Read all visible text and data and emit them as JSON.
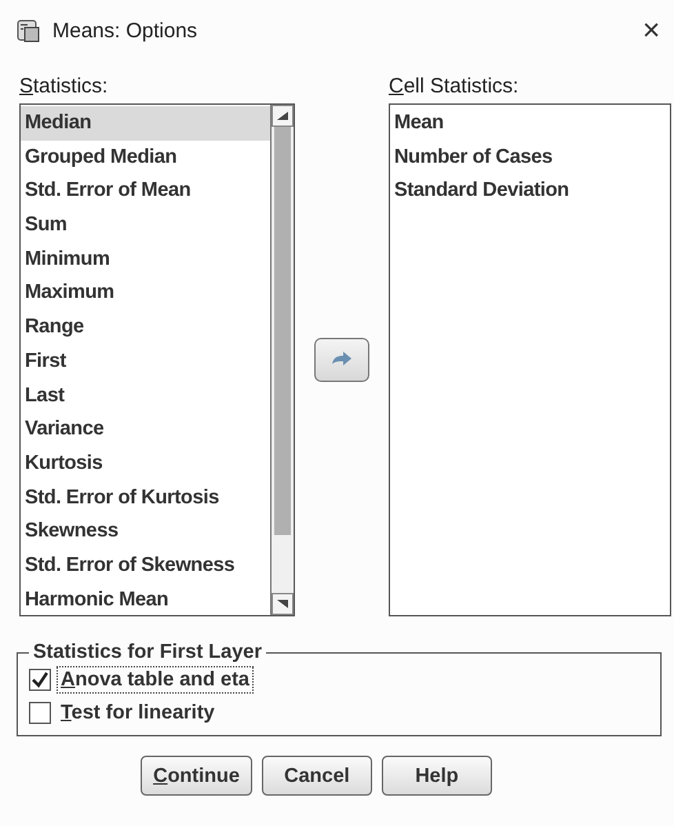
{
  "window": {
    "title": "Means: Options",
    "close": "×"
  },
  "statistics": {
    "label": "Statistics:",
    "mnemonic_first": true,
    "items": [
      {
        "label": "Median",
        "selected": true
      },
      {
        "label": "Grouped Median",
        "selected": false
      },
      {
        "label": "Std. Error of Mean",
        "selected": false
      },
      {
        "label": "Sum",
        "selected": false
      },
      {
        "label": "Minimum",
        "selected": false
      },
      {
        "label": "Maximum",
        "selected": false
      },
      {
        "label": "Range",
        "selected": false
      },
      {
        "label": "First",
        "selected": false
      },
      {
        "label": "Last",
        "selected": false
      },
      {
        "label": "Variance",
        "selected": false
      },
      {
        "label": "Kurtosis",
        "selected": false
      },
      {
        "label": "Std. Error of Kurtosis",
        "selected": false
      },
      {
        "label": "Skewness",
        "selected": false
      },
      {
        "label": "Std. Error of Skewness",
        "selected": false
      },
      {
        "label": "Harmonic Mean",
        "selected": false
      }
    ]
  },
  "cell_statistics": {
    "label": "Cell Statistics:",
    "mnemonic_first": true,
    "items": [
      {
        "label": "Mean",
        "selected": false
      },
      {
        "label": "Number of Cases",
        "selected": false
      },
      {
        "label": "Standard Deviation",
        "selected": false
      }
    ]
  },
  "first_layer": {
    "title": "Statistics for First Layer",
    "options": [
      {
        "label": "Anova table and eta",
        "checked": true,
        "focused": true,
        "mnemonic_first": true
      },
      {
        "label": "Test for linearity",
        "checked": false,
        "focused": false,
        "mnemonic_first": true
      }
    ]
  },
  "buttons": [
    {
      "label": "Continue",
      "mnemonic_first": true
    },
    {
      "label": "Cancel",
      "mnemonic_first": false
    },
    {
      "label": "Help",
      "mnemonic_first": false
    }
  ]
}
